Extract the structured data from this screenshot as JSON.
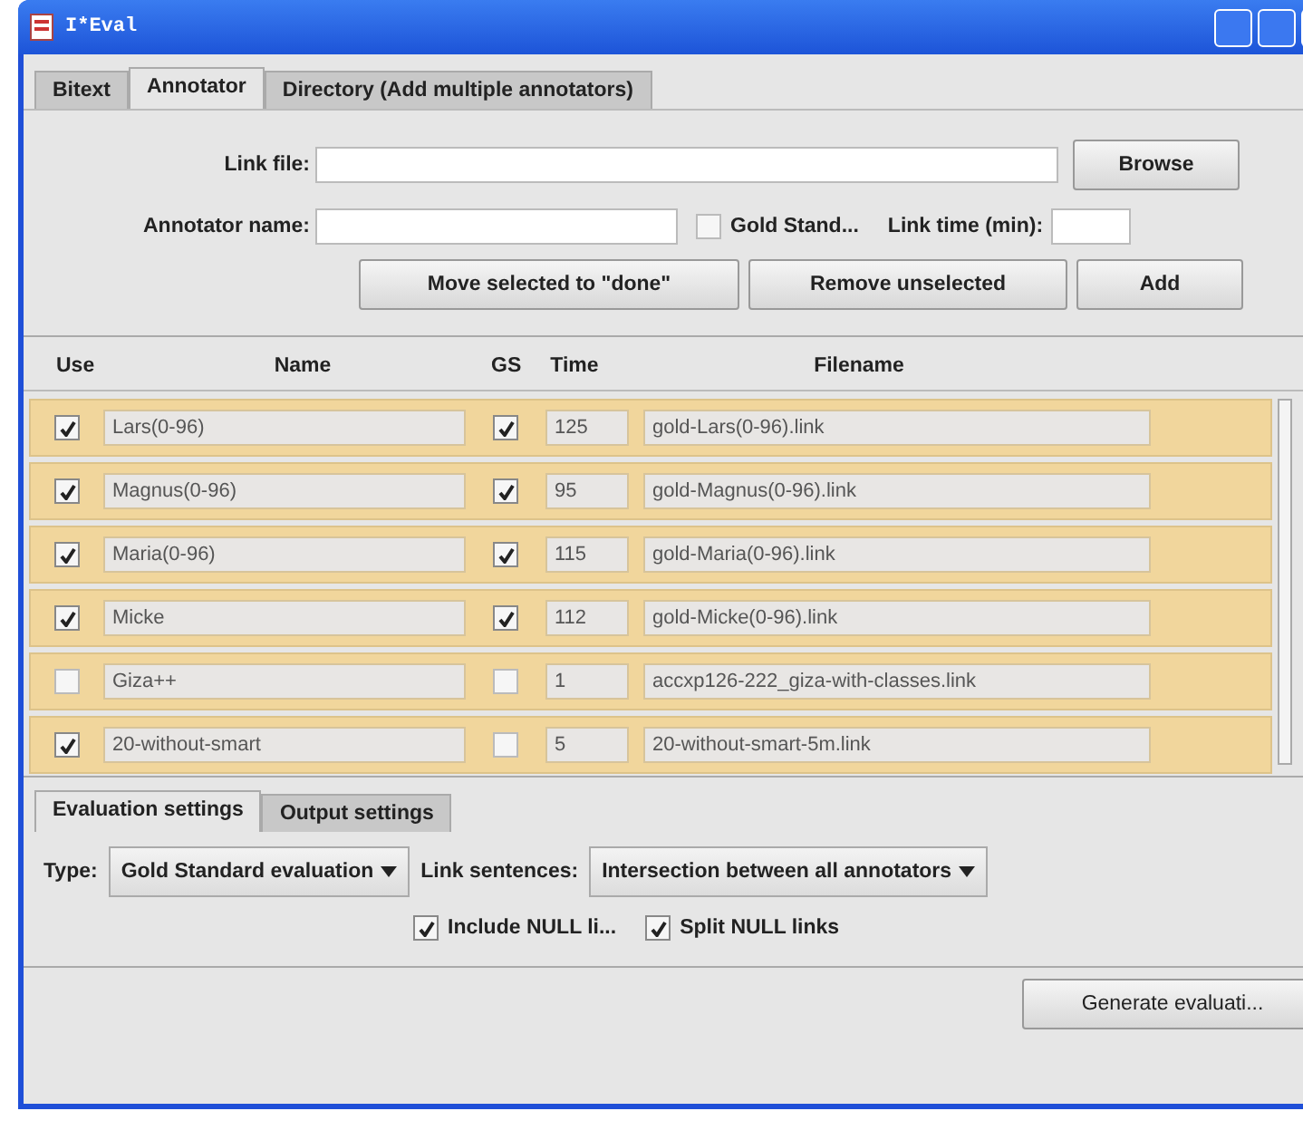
{
  "window": {
    "title": "I*Eval"
  },
  "tabs": [
    {
      "label": "Bitext",
      "selected": false
    },
    {
      "label": "Annotator",
      "selected": true
    },
    {
      "label": "Directory (Add multiple annotators)",
      "selected": false
    }
  ],
  "link_file": {
    "label": "Link file:",
    "button": "Browse"
  },
  "annotator": {
    "name_label": "Annotator name:",
    "gold_standard": {
      "label": "Gold Stand...",
      "checked": false
    },
    "time_label": "Link time (min):"
  },
  "actions": [
    "Move selected to \"done\"",
    "Remove unselected",
    "Add"
  ],
  "table": {
    "columns": [
      "Use",
      "Name",
      "GS",
      "Time",
      "Filename"
    ],
    "rows": [
      {
        "use": true,
        "name": "Lars(0-96)",
        "gs": true,
        "time": "125",
        "filename": "gold-Lars(0-96).link"
      },
      {
        "use": true,
        "name": "Magnus(0-96)",
        "gs": true,
        "time": "95",
        "filename": "gold-Magnus(0-96).link"
      },
      {
        "use": true,
        "name": "Maria(0-96)",
        "gs": true,
        "time": "115",
        "filename": "gold-Maria(0-96).link"
      },
      {
        "use": true,
        "name": "Micke",
        "gs": true,
        "time": "112",
        "filename": "gold-Micke(0-96).link"
      },
      {
        "use": false,
        "name": "Giza++",
        "gs": false,
        "time": "1",
        "filename": "accxp126-222_giza-with-classes.link"
      },
      {
        "use": true,
        "name": "20-without-smart",
        "gs": false,
        "time": "5",
        "filename": "20-without-smart-5m.link"
      }
    ]
  },
  "settings_tabs": [
    {
      "label": "Evaluation settings",
      "selected": true
    },
    {
      "label": "Output settings",
      "selected": false
    }
  ],
  "evaluation": {
    "type_label": "Type:",
    "type_value": "Gold Standard evaluation",
    "sentences_label": "Link sentences:",
    "sentences_value": "Intersection between all annotators",
    "options": [
      {
        "label": "Include NULL li...",
        "checked": true
      },
      {
        "label": "Split NULL links",
        "checked": true
      }
    ]
  },
  "generate_button": "Generate evaluati..."
}
